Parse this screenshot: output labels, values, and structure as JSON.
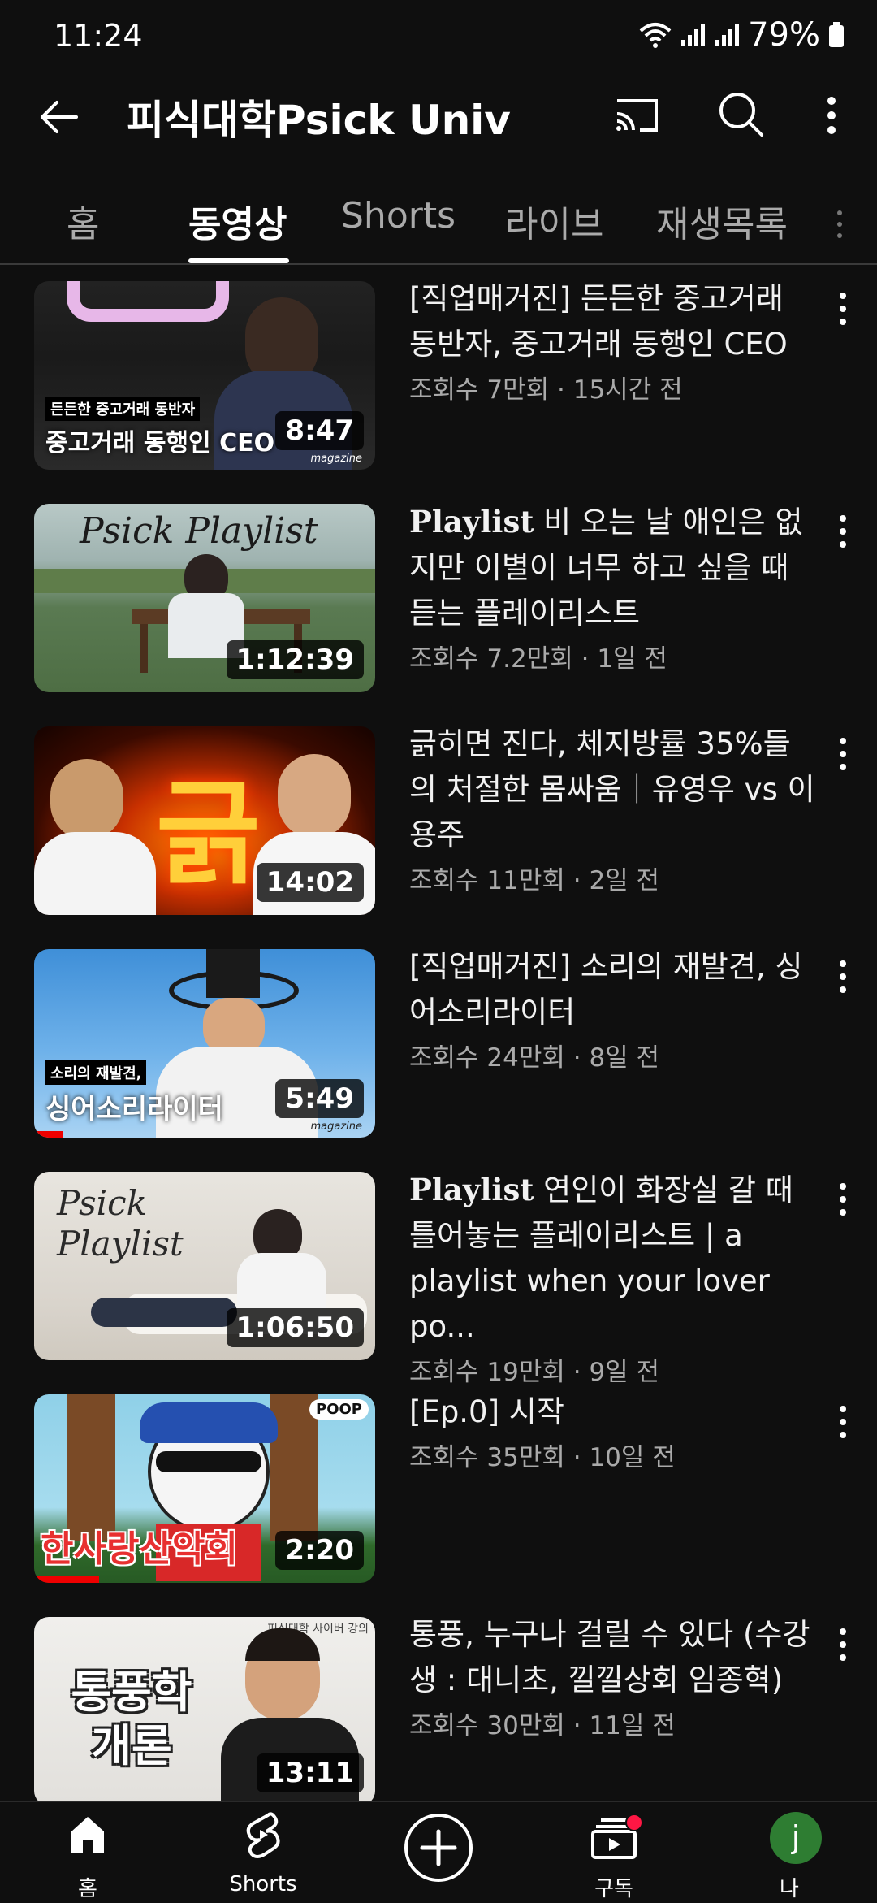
{
  "status_bar": {
    "time": "11:24",
    "battery": "79%"
  },
  "header": {
    "channel_name": "피식대학Psick Univ"
  },
  "tabs": [
    {
      "label": "홈"
    },
    {
      "label": "동영상"
    },
    {
      "label": "Shorts"
    },
    {
      "label": "라이브"
    },
    {
      "label": "재생목록"
    }
  ],
  "videos": [
    {
      "title": "[직업매거진] 든든한 중고거래 동반자, 중고거래 동행인 CEO",
      "meta": "조회수 7만회 · 15시간 전",
      "duration": "8:47",
      "thumb_small": "든든한 중고거래 동반자",
      "thumb_big": "중고거래 동행인 CEO",
      "thumb_brand": "magazine"
    },
    {
      "title_prefix": "Playlist",
      "title": " 비 오는 날 애인은 없지만 이별이 너무 하고 싶을 때 듣는 플레이리스트",
      "meta": "조회수 7.2만회 · 1일 전",
      "duration": "1:12:39",
      "thumb_big": "Psick Playlist"
    },
    {
      "title": "긁히면 진다, 체지방률 35%들의 처절한 몸싸움｜유영우 vs 이용주",
      "meta": "조회수 11만회 · 2일 전",
      "duration": "14:02",
      "thumb_big": "긁"
    },
    {
      "title": "[직업매거진] 소리의 재발견, 싱어소리라이터",
      "meta": "조회수 24만회 · 8일 전",
      "duration": "5:49",
      "thumb_small": "소리의 재발견,",
      "thumb_big": "싱어소리라이터",
      "thumb_brand": "magazine"
    },
    {
      "title_prefix": "Playlist",
      "title": " 연인이 화장실 갈 때 틀어놓는 플레이리스트 | a playlist when your lover po...",
      "meta": "조회수 19만회 · 9일 전",
      "duration": "1:06:50",
      "thumb_big": "Psick Playlist"
    },
    {
      "title": "[Ep.0] 시작",
      "meta": "조회수 35만회 · 10일 전",
      "duration": "2:20",
      "thumb_big": "한사랑산악회",
      "thumb_badge": "POOP"
    },
    {
      "title": "통풍, 누구나 걸릴 수 있다 (수강생 : 대니초, 낄낄상회 임종혁)",
      "meta": "조회수 30만회 · 11일 전",
      "duration": "13:11",
      "thumb_big": "통풍학 개론",
      "thumb_small": "피식대학 사이버 강의"
    }
  ],
  "bottom_nav": [
    {
      "label": "홈"
    },
    {
      "label": "Shorts"
    },
    {
      "label": ""
    },
    {
      "label": "구독"
    },
    {
      "label": "나",
      "avatar_letter": "j"
    }
  ]
}
